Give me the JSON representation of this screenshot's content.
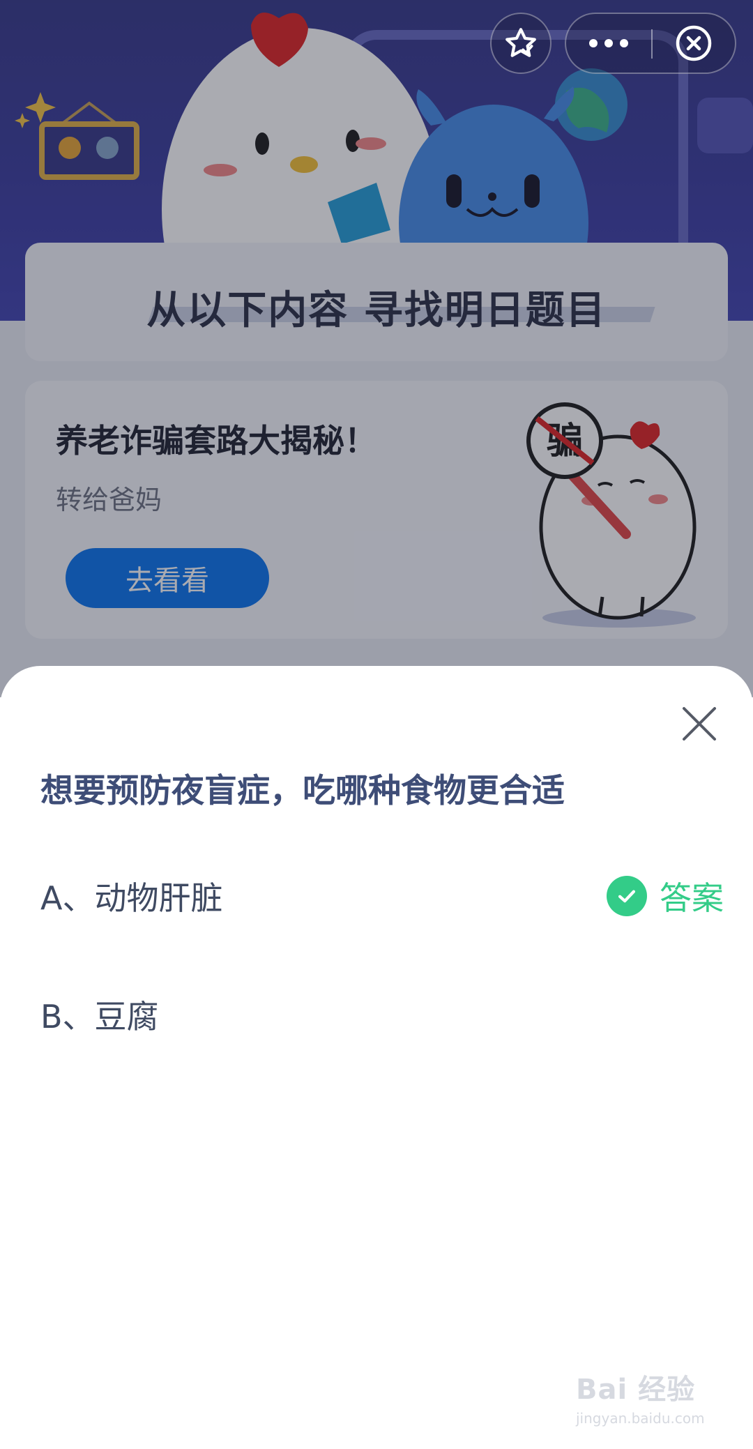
{
  "background": {
    "section_title": "从以下内容  寻找明日题目",
    "promo": {
      "title": "养老诈骗套路大揭秘！",
      "subtitle": "转给爸妈",
      "button_label": "去看看",
      "sign_text": "骗"
    }
  },
  "top_controls": {
    "icons": [
      "star-icon",
      "more-icon",
      "close-circle-icon"
    ]
  },
  "quiz": {
    "question": "想要预防夜盲症，吃哪种食物更合适",
    "options": [
      {
        "label": "A、动物肝脏",
        "is_answer": true
      },
      {
        "label": "B、豆腐",
        "is_answer": false
      }
    ],
    "answer_label": "答案"
  },
  "watermark": {
    "main": "Bai 经验",
    "sub": "jingyan.baidu.com"
  },
  "colors": {
    "hero_bg": "#3f41a0",
    "question_text": "#3e4d77",
    "answer_green": "#33cc88",
    "button_blue": "#1177ee"
  }
}
